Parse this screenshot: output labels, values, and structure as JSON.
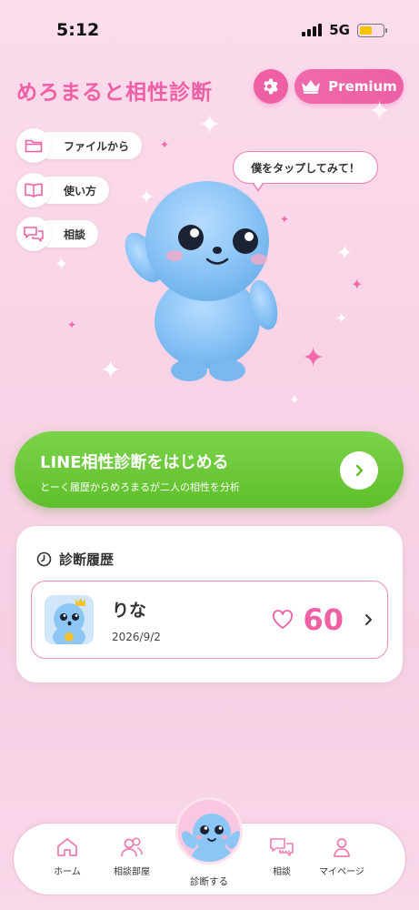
{
  "status": {
    "time": "5:12",
    "network": "5G"
  },
  "header": {
    "title": "めろまると相性診断",
    "premium_label": "Premium"
  },
  "side_menu": [
    {
      "label": "ファイルから",
      "icon": "folder-icon"
    },
    {
      "label": "使い方",
      "icon": "book-icon"
    },
    {
      "label": "相談",
      "icon": "chat-icon"
    }
  ],
  "mascot": {
    "bubble_text": "僕をタップしてみて！"
  },
  "cta": {
    "title": "LINE相性診断をはじめる",
    "subtitle": "とーく履歴からめろまるが二人の相性を分析"
  },
  "history": {
    "title": "診断履歴",
    "items": [
      {
        "name": "りな",
        "date": "2026/9/2",
        "score": "60"
      }
    ]
  },
  "nav": {
    "items": [
      {
        "label": "ホーム",
        "icon": "home-icon"
      },
      {
        "label": "相談部屋",
        "icon": "people-icon"
      },
      {
        "label": "診断する",
        "icon": "mascot-icon"
      },
      {
        "label": "相談",
        "icon": "chat-icon"
      },
      {
        "label": "マイページ",
        "icon": "user-icon"
      }
    ]
  },
  "colors": {
    "accent": "#ee5fa4",
    "cta_green": "#66c434",
    "background": "#f8d3e6"
  }
}
